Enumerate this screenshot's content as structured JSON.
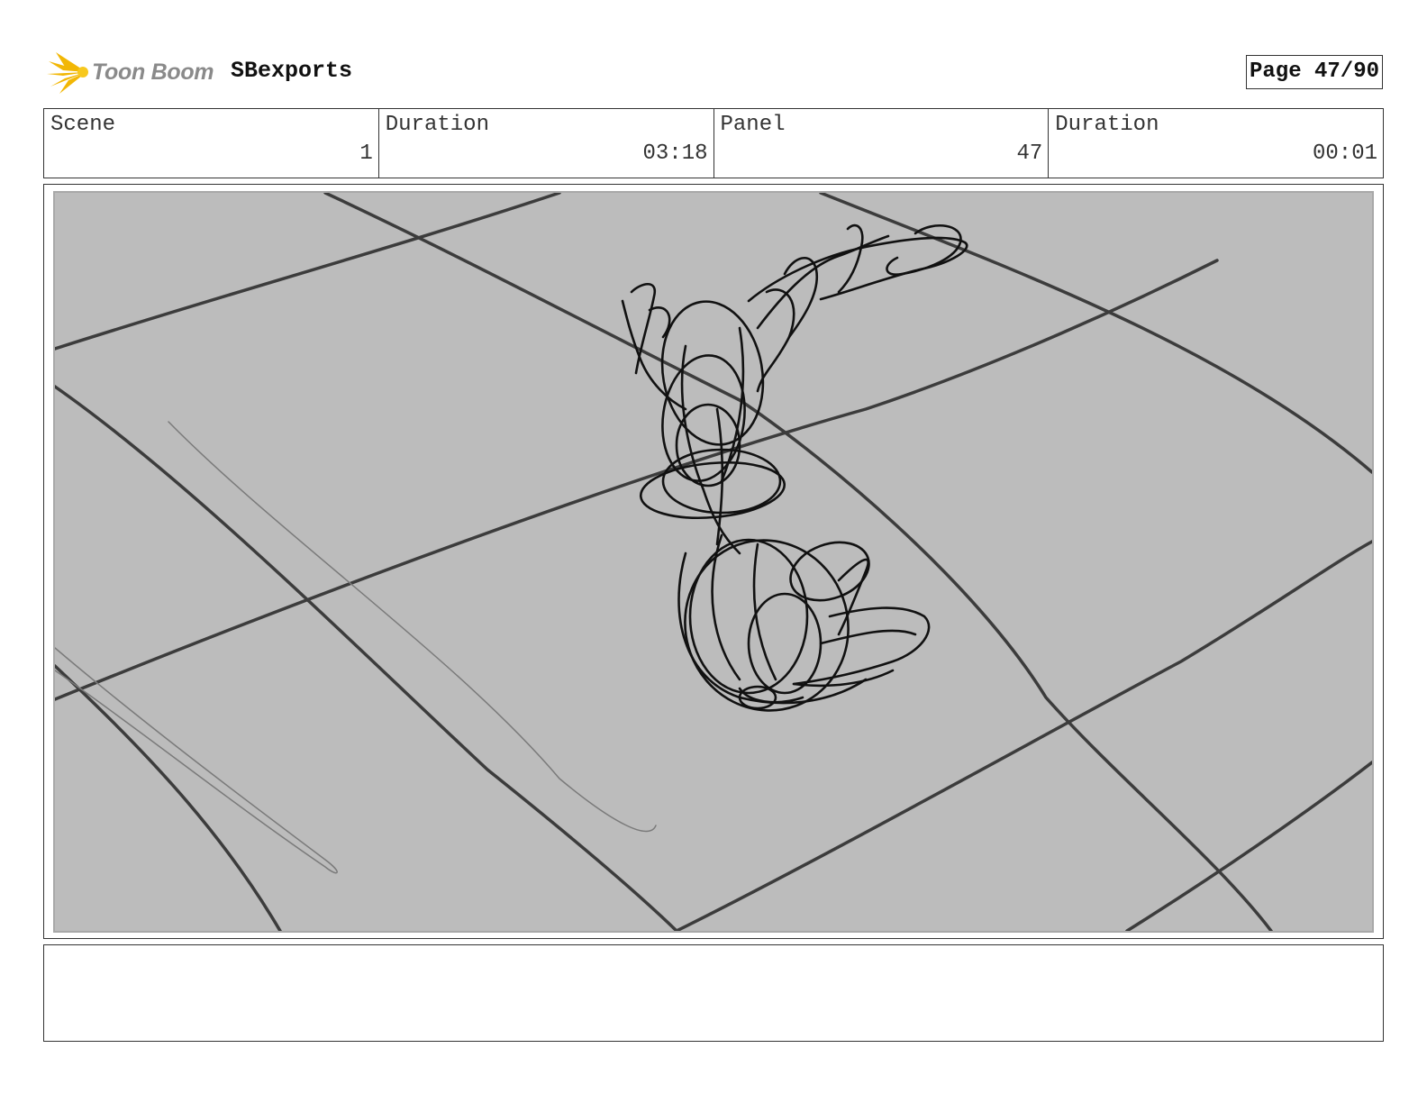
{
  "header": {
    "logo_text": "Toon Boom",
    "project_title": "SBexports",
    "page_label": "Page 47/90"
  },
  "info": [
    {
      "label": "Scene",
      "value": "1"
    },
    {
      "label": "Duration",
      "value": "03:18"
    },
    {
      "label": "Panel",
      "value": "47"
    },
    {
      "label": "Duration",
      "value": "00:01"
    }
  ],
  "panel": {
    "background_color": "#bcbcbc",
    "sketch_color": "#111111",
    "grid_color": "#3c3c3c"
  },
  "caption": {
    "text": ""
  }
}
